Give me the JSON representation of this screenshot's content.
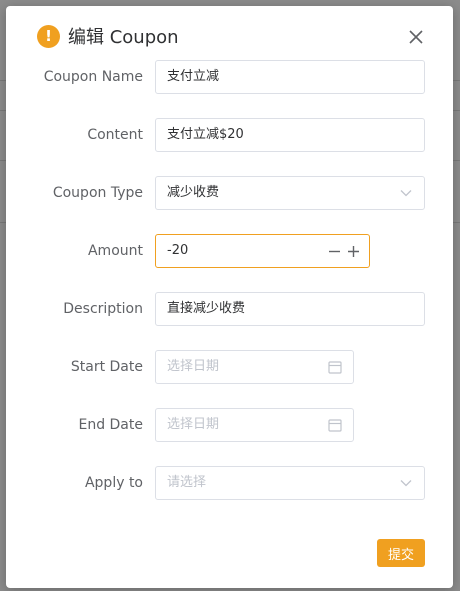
{
  "dialog": {
    "title": "编辑 Coupon",
    "warn_icon_glyph": "!",
    "submit_label": "提交"
  },
  "fields": {
    "coupon_name": {
      "label": "Coupon Name",
      "value": "支付立减"
    },
    "content": {
      "label": "Content",
      "value": "支付立减$20"
    },
    "coupon_type": {
      "label": "Coupon Type",
      "value": "减少收费"
    },
    "amount": {
      "label": "Amount",
      "value": "-20"
    },
    "description": {
      "label": "Description",
      "value": "直接减少收费"
    },
    "start_date": {
      "label": "Start Date",
      "placeholder": "选择日期"
    },
    "end_date": {
      "label": "End Date",
      "placeholder": "选择日期"
    },
    "apply_to": {
      "label": "Apply to",
      "placeholder": "请选择"
    }
  },
  "colors": {
    "accent": "#f0a020",
    "border": "#dcdfe6",
    "placeholder": "#c0c4cc",
    "label": "#606266"
  },
  "icons": {
    "warning": "warning-icon",
    "close": "close-icon",
    "select_caret": "chevron-down-icon",
    "calendar": "calendar-icon",
    "minus": "minus-icon",
    "plus": "plus-icon"
  }
}
